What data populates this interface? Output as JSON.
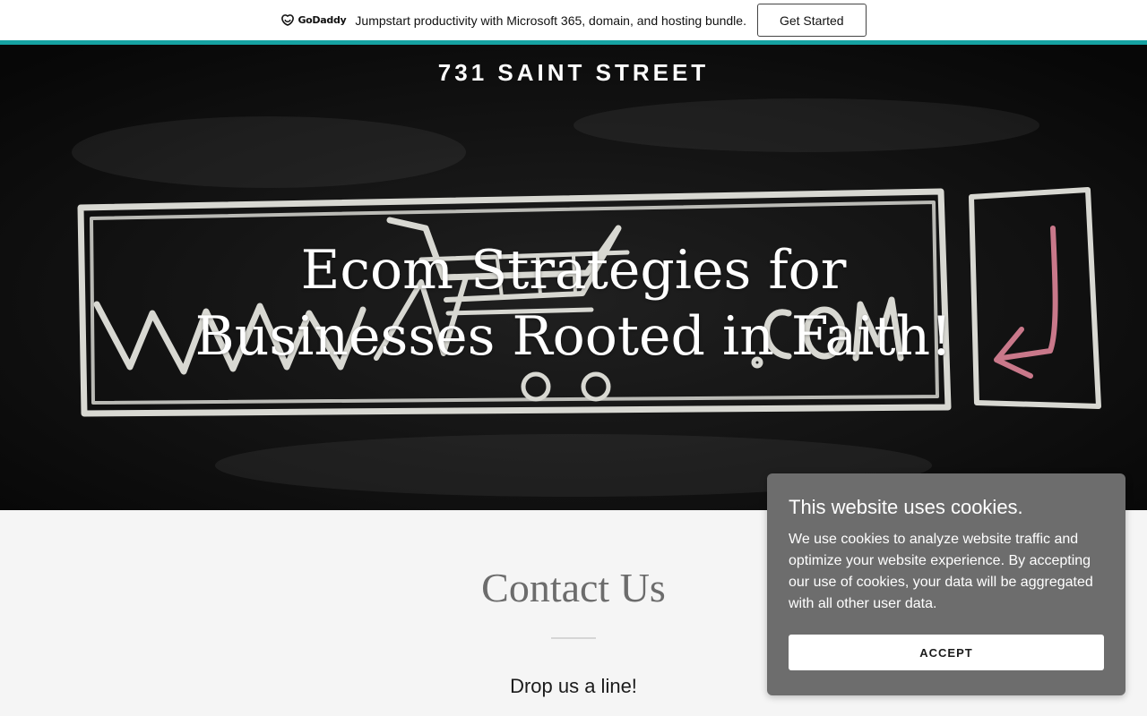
{
  "promo": {
    "logo_text": "GoDaddy",
    "message": "Jumpstart productivity with Microsoft 365, domain, and hosting bundle.",
    "cta_label": "Get Started",
    "accent_color": "#16a2a2"
  },
  "header": {
    "site_title": "731 SAINT STREET"
  },
  "hero": {
    "heading_line1": "Ecom Strategies for",
    "heading_line2": "Businesses Rooted in Faith!"
  },
  "contact": {
    "title": "Contact Us",
    "subtitle": "Drop us a line!"
  },
  "cookie_banner": {
    "title": "This website uses cookies.",
    "body": "We use cookies to analyze website traffic and optimize your website experience. By accepting our use of cookies, your data will be aggregated with all other user data.",
    "accept_label": "ACCEPT",
    "background_color": "#6d6d6d"
  }
}
